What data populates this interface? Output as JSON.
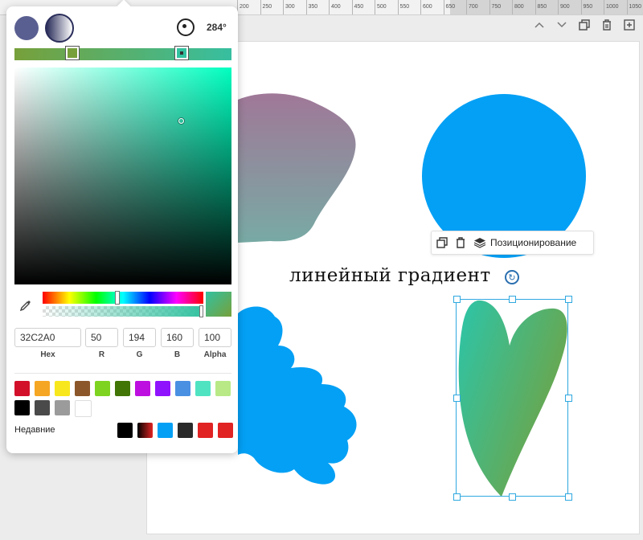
{
  "ruler": {
    "ticks": [
      "200",
      "250",
      "300",
      "350",
      "400",
      "450",
      "500",
      "550",
      "600",
      "650",
      "700",
      "750",
      "800",
      "850",
      "900",
      "950",
      "1000",
      "1050"
    ]
  },
  "toolbar": {
    "icons": [
      "chevron-up-icon",
      "chevron-down-icon",
      "duplicate-icon",
      "trash-icon",
      "add-icon"
    ]
  },
  "color_picker": {
    "angle": "284°",
    "hex": "32C2A0",
    "r": "50",
    "g": "194",
    "b": "160",
    "alpha": "100",
    "labels": {
      "hex": "Hex",
      "r": "R",
      "g": "G",
      "b": "B",
      "alpha": "Alpha"
    },
    "presets": [
      "#d3102a",
      "#f5a623",
      "#f8e71c",
      "#8b572a",
      "#7ed321",
      "#417505",
      "#bd10e0",
      "#9013fe",
      "#4a90e2",
      "#50e3c2",
      "#b8e986",
      "#000000",
      "#4a4a4a",
      "#9b9b9b",
      "#ffffff"
    ],
    "recent_label": "Недавние",
    "recent": [
      "#000000",
      "gradient-black-red",
      "#04a0f5",
      "#2a2a2a",
      "#e12323",
      "#e12323"
    ]
  },
  "canvas": {
    "text": "линейный градиент",
    "context_menu": {
      "label": "Позиционирование"
    }
  }
}
